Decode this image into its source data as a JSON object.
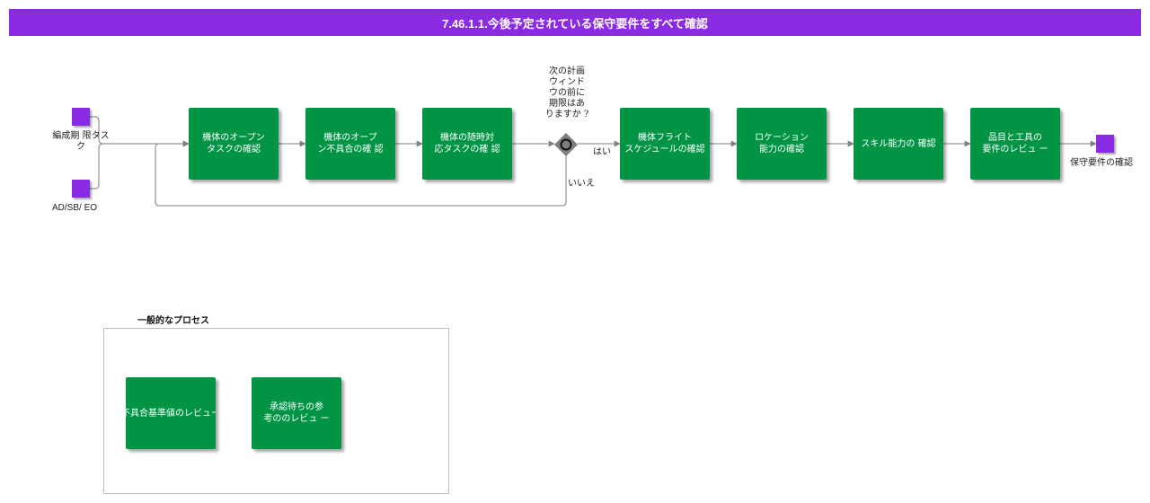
{
  "title": "7.46.1.1.今後予定されている保守要件をすべて確認",
  "inputs": {
    "unit_limit_task": "編成期 限タスク",
    "ad_sb_eo": "AD/SB/ EO"
  },
  "output": {
    "label": "保守要件の確認"
  },
  "tasks": [
    {
      "label": "機体のオープン\nタスクの確認"
    },
    {
      "label": "機体のオープ\nン不具合の確 認"
    },
    {
      "label": "機体の随時対\n応タスクの確 認"
    },
    {
      "label": "機体フライト\nスケジュールの確認"
    },
    {
      "label": "ロケーション\n能力の確認"
    },
    {
      "label": "スキル能力の 確認"
    },
    {
      "label": "品目と工具の\n要件のレビュ ー"
    }
  ],
  "gateway": {
    "question": "次の計画\nウィンド\nウの前に\n期限はあ\nりますか ?",
    "yes_label": "はい",
    "no_label": "いいえ"
  },
  "general_process": {
    "title": "一般的なプロセス",
    "tasks": [
      {
        "label": "不具合基準値のレビュー"
      },
      {
        "label": "承認待ちの参\n考ののレビュ ー"
      }
    ]
  },
  "colors": {
    "title_bar": "#8a2be2",
    "task_fill": "#009444",
    "node_fill": "#8a2be2",
    "connector": "#7f7f7f"
  }
}
